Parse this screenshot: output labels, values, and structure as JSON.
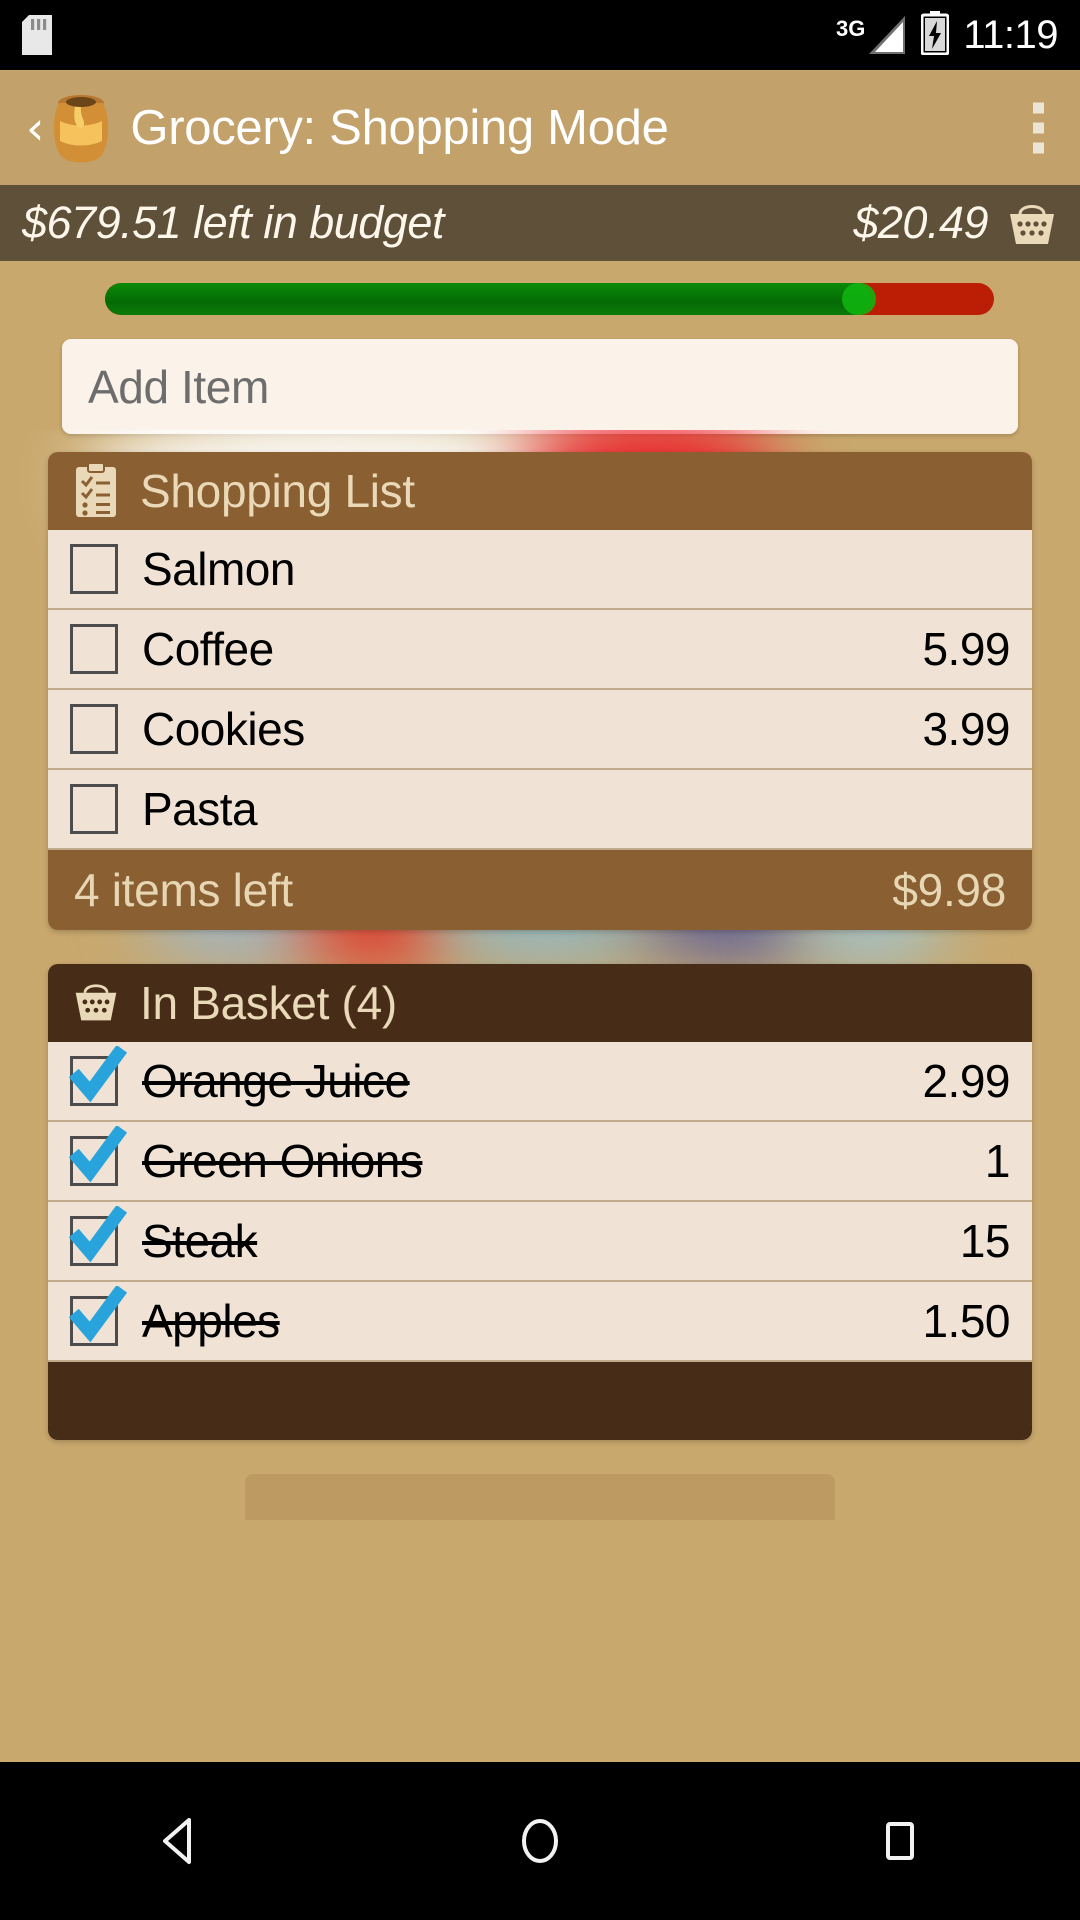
{
  "status_bar": {
    "sd_icon": "sd-card-icon",
    "network_label": "3G",
    "signal_icon": "signal-bars-icon",
    "battery_icon": "battery-charging-icon",
    "clock": "11:19"
  },
  "action_bar": {
    "back_label": "‹",
    "logo_icon": "honey-pot-icon",
    "title": "Grocery: Shopping Mode",
    "overflow_icon": "overflow-menu-icon"
  },
  "budget": {
    "left_text": "$679.51 left in budget",
    "basket_total": "$20.49",
    "basket_icon": "shopping-basket-icon",
    "progress_percent": 86,
    "colors": {
      "spent": "#046b04",
      "remaining": "#bb1d05",
      "bar_cap": "#0fb40f"
    }
  },
  "add_item": {
    "placeholder": "Add Item",
    "value": ""
  },
  "shopping_list": {
    "icon": "clipboard-checklist-icon",
    "title": "Shopping List",
    "items": [
      {
        "name": "Salmon",
        "price": "",
        "checked": false
      },
      {
        "name": "Coffee",
        "price": "5.99",
        "checked": false
      },
      {
        "name": "Cookies",
        "price": "3.99",
        "checked": false
      },
      {
        "name": "Pasta",
        "price": "",
        "checked": false
      }
    ],
    "footer_left": "4 items left",
    "footer_right": "$9.98"
  },
  "in_basket": {
    "icon": "shopping-basket-icon",
    "title": "In Basket (4)",
    "items": [
      {
        "name": "Orange Juice",
        "price": "2.99",
        "checked": true
      },
      {
        "name": "Green Onions",
        "price": "1",
        "checked": true
      },
      {
        "name": "Steak",
        "price": "15",
        "checked": true
      },
      {
        "name": "Apples",
        "price": "1.50",
        "checked": true
      }
    ],
    "footer_left": "",
    "footer_right": ""
  },
  "nav_bar": {
    "back_icon": "nav-back-icon",
    "home_icon": "nav-home-icon",
    "recents_icon": "nav-recents-icon"
  }
}
